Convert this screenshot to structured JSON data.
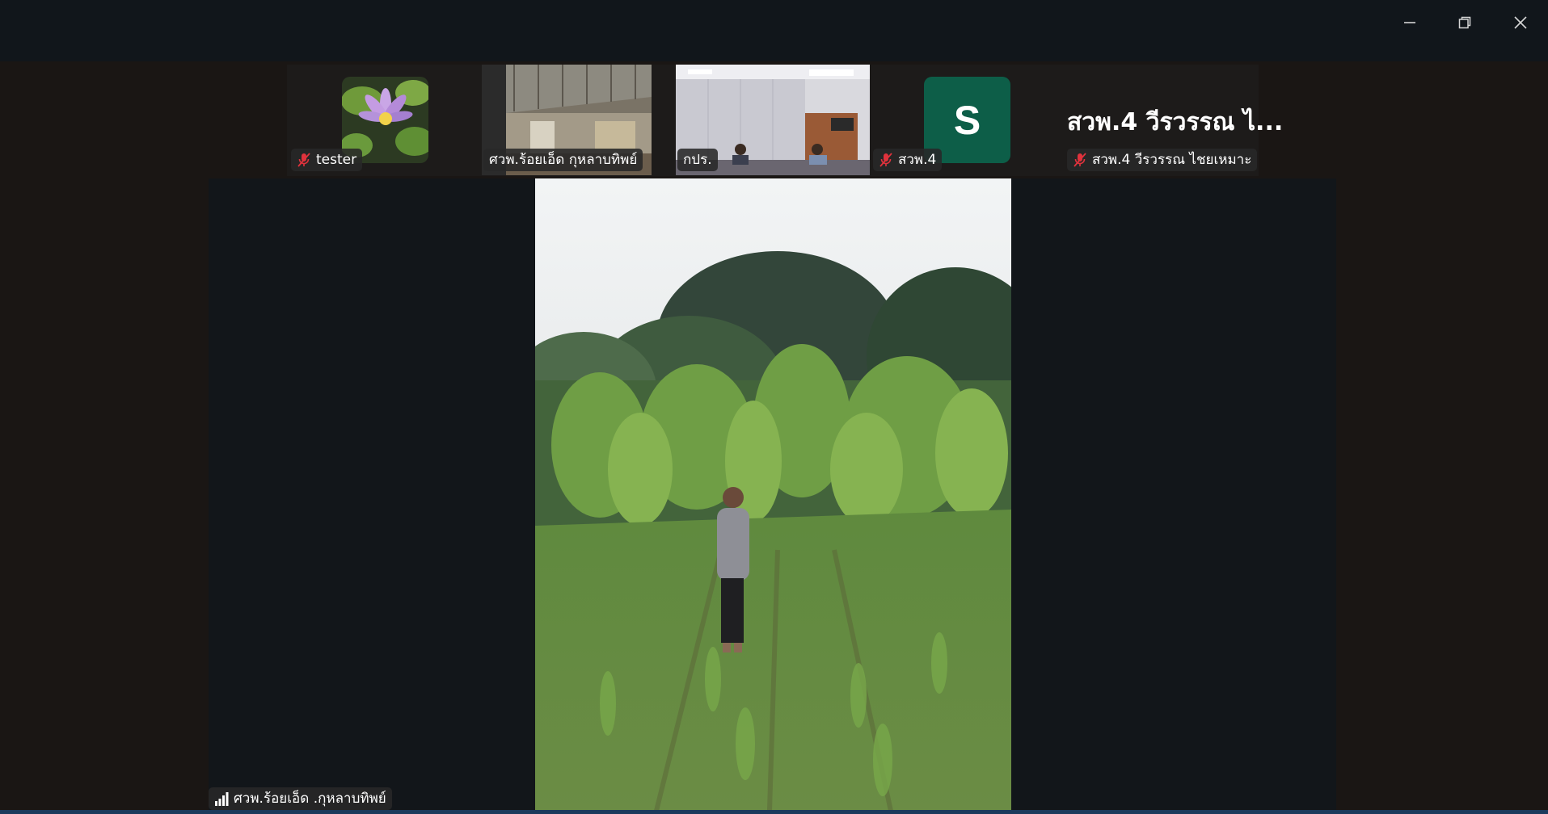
{
  "window_controls": {
    "minimize_icon": "minimize-icon",
    "restore_icon": "restore-icon",
    "close_icon": "close-icon"
  },
  "participants": [
    {
      "name": "tester",
      "muted": true,
      "thumbnail": "water-lily-photo"
    },
    {
      "name": "ศวพ.ร้อยเอ็ด กุหลาบทิพย์",
      "muted": false,
      "thumbnail": "shed-video"
    },
    {
      "name": "กปร.",
      "muted": false,
      "thumbnail": "meeting-room-video"
    },
    {
      "name": "สวพ.4",
      "muted": true,
      "avatar_letter": "S",
      "avatar_color": "#0d5e48"
    },
    {
      "name": "สวพ.4 วีรวรรณ ไชยเหมาะ",
      "muted": true,
      "display_title": "สวพ.4 วีรวรรณ ไ..."
    }
  ],
  "active_speaker": {
    "name": "ศวพ.ร้อยเอ็ด .กุหลาบทิพย์",
    "signal_icon": "signal-strength-icon",
    "video": "field-video"
  },
  "colors": {
    "titlebar": "#11161b",
    "stage": "#12161a",
    "mic_off": "#e0323c",
    "avatar": "#0d5e48"
  }
}
